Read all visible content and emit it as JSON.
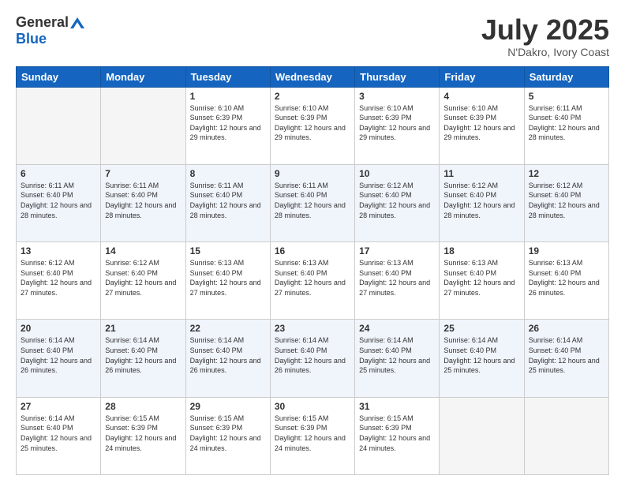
{
  "header": {
    "logo_general": "General",
    "logo_blue": "Blue",
    "month_title": "July 2025",
    "subtitle": "N'Dakro, Ivory Coast"
  },
  "days_of_week": [
    "Sunday",
    "Monday",
    "Tuesday",
    "Wednesday",
    "Thursday",
    "Friday",
    "Saturday"
  ],
  "weeks": [
    [
      {
        "day": "",
        "empty": true
      },
      {
        "day": "",
        "empty": true
      },
      {
        "day": "1",
        "sunrise": "Sunrise: 6:10 AM",
        "sunset": "Sunset: 6:39 PM",
        "daylight": "Daylight: 12 hours and 29 minutes."
      },
      {
        "day": "2",
        "sunrise": "Sunrise: 6:10 AM",
        "sunset": "Sunset: 6:39 PM",
        "daylight": "Daylight: 12 hours and 29 minutes."
      },
      {
        "day": "3",
        "sunrise": "Sunrise: 6:10 AM",
        "sunset": "Sunset: 6:39 PM",
        "daylight": "Daylight: 12 hours and 29 minutes."
      },
      {
        "day": "4",
        "sunrise": "Sunrise: 6:10 AM",
        "sunset": "Sunset: 6:39 PM",
        "daylight": "Daylight: 12 hours and 29 minutes."
      },
      {
        "day": "5",
        "sunrise": "Sunrise: 6:11 AM",
        "sunset": "Sunset: 6:40 PM",
        "daylight": "Daylight: 12 hours and 28 minutes."
      }
    ],
    [
      {
        "day": "6",
        "sunrise": "Sunrise: 6:11 AM",
        "sunset": "Sunset: 6:40 PM",
        "daylight": "Daylight: 12 hours and 28 minutes."
      },
      {
        "day": "7",
        "sunrise": "Sunrise: 6:11 AM",
        "sunset": "Sunset: 6:40 PM",
        "daylight": "Daylight: 12 hours and 28 minutes."
      },
      {
        "day": "8",
        "sunrise": "Sunrise: 6:11 AM",
        "sunset": "Sunset: 6:40 PM",
        "daylight": "Daylight: 12 hours and 28 minutes."
      },
      {
        "day": "9",
        "sunrise": "Sunrise: 6:11 AM",
        "sunset": "Sunset: 6:40 PM",
        "daylight": "Daylight: 12 hours and 28 minutes."
      },
      {
        "day": "10",
        "sunrise": "Sunrise: 6:12 AM",
        "sunset": "Sunset: 6:40 PM",
        "daylight": "Daylight: 12 hours and 28 minutes."
      },
      {
        "day": "11",
        "sunrise": "Sunrise: 6:12 AM",
        "sunset": "Sunset: 6:40 PM",
        "daylight": "Daylight: 12 hours and 28 minutes."
      },
      {
        "day": "12",
        "sunrise": "Sunrise: 6:12 AM",
        "sunset": "Sunset: 6:40 PM",
        "daylight": "Daylight: 12 hours and 28 minutes."
      }
    ],
    [
      {
        "day": "13",
        "sunrise": "Sunrise: 6:12 AM",
        "sunset": "Sunset: 6:40 PM",
        "daylight": "Daylight: 12 hours and 27 minutes."
      },
      {
        "day": "14",
        "sunrise": "Sunrise: 6:12 AM",
        "sunset": "Sunset: 6:40 PM",
        "daylight": "Daylight: 12 hours and 27 minutes."
      },
      {
        "day": "15",
        "sunrise": "Sunrise: 6:13 AM",
        "sunset": "Sunset: 6:40 PM",
        "daylight": "Daylight: 12 hours and 27 minutes."
      },
      {
        "day": "16",
        "sunrise": "Sunrise: 6:13 AM",
        "sunset": "Sunset: 6:40 PM",
        "daylight": "Daylight: 12 hours and 27 minutes."
      },
      {
        "day": "17",
        "sunrise": "Sunrise: 6:13 AM",
        "sunset": "Sunset: 6:40 PM",
        "daylight": "Daylight: 12 hours and 27 minutes."
      },
      {
        "day": "18",
        "sunrise": "Sunrise: 6:13 AM",
        "sunset": "Sunset: 6:40 PM",
        "daylight": "Daylight: 12 hours and 27 minutes."
      },
      {
        "day": "19",
        "sunrise": "Sunrise: 6:13 AM",
        "sunset": "Sunset: 6:40 PM",
        "daylight": "Daylight: 12 hours and 26 minutes."
      }
    ],
    [
      {
        "day": "20",
        "sunrise": "Sunrise: 6:14 AM",
        "sunset": "Sunset: 6:40 PM",
        "daylight": "Daylight: 12 hours and 26 minutes."
      },
      {
        "day": "21",
        "sunrise": "Sunrise: 6:14 AM",
        "sunset": "Sunset: 6:40 PM",
        "daylight": "Daylight: 12 hours and 26 minutes."
      },
      {
        "day": "22",
        "sunrise": "Sunrise: 6:14 AM",
        "sunset": "Sunset: 6:40 PM",
        "daylight": "Daylight: 12 hours and 26 minutes."
      },
      {
        "day": "23",
        "sunrise": "Sunrise: 6:14 AM",
        "sunset": "Sunset: 6:40 PM",
        "daylight": "Daylight: 12 hours and 26 minutes."
      },
      {
        "day": "24",
        "sunrise": "Sunrise: 6:14 AM",
        "sunset": "Sunset: 6:40 PM",
        "daylight": "Daylight: 12 hours and 25 minutes."
      },
      {
        "day": "25",
        "sunrise": "Sunrise: 6:14 AM",
        "sunset": "Sunset: 6:40 PM",
        "daylight": "Daylight: 12 hours and 25 minutes."
      },
      {
        "day": "26",
        "sunrise": "Sunrise: 6:14 AM",
        "sunset": "Sunset: 6:40 PM",
        "daylight": "Daylight: 12 hours and 25 minutes."
      }
    ],
    [
      {
        "day": "27",
        "sunrise": "Sunrise: 6:14 AM",
        "sunset": "Sunset: 6:40 PM",
        "daylight": "Daylight: 12 hours and 25 minutes."
      },
      {
        "day": "28",
        "sunrise": "Sunrise: 6:15 AM",
        "sunset": "Sunset: 6:39 PM",
        "daylight": "Daylight: 12 hours and 24 minutes."
      },
      {
        "day": "29",
        "sunrise": "Sunrise: 6:15 AM",
        "sunset": "Sunset: 6:39 PM",
        "daylight": "Daylight: 12 hours and 24 minutes."
      },
      {
        "day": "30",
        "sunrise": "Sunrise: 6:15 AM",
        "sunset": "Sunset: 6:39 PM",
        "daylight": "Daylight: 12 hours and 24 minutes."
      },
      {
        "day": "31",
        "sunrise": "Sunrise: 6:15 AM",
        "sunset": "Sunset: 6:39 PM",
        "daylight": "Daylight: 12 hours and 24 minutes."
      },
      {
        "day": "",
        "empty": true
      },
      {
        "day": "",
        "empty": true
      }
    ]
  ]
}
